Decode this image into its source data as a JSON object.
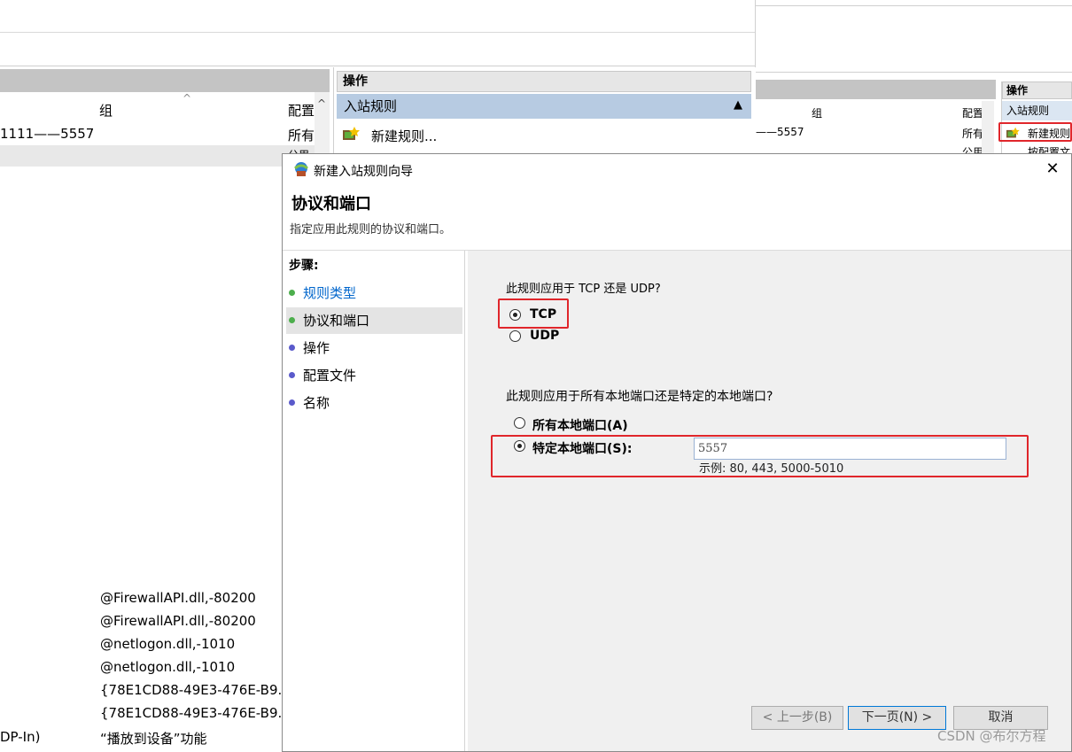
{
  "background": {
    "table_header": {
      "col_group": "组",
      "col_profile": "配置",
      "sort_arrow": "^"
    },
    "first_row": {
      "name": "1111——5557",
      "profile": "所有"
    },
    "second_row_profile": "公用",
    "rows": [
      {
        "group": "@FirewallAPI.dll,-80200"
      },
      {
        "group": "@FirewallAPI.dll,-80200"
      },
      {
        "group": "@netlogon.dll,-1010"
      },
      {
        "group": "@netlogon.dll,-1010"
      },
      {
        "group": "{78E1CD88-49E3-476E-B9..."
      },
      {
        "group": "{78E1CD88-49E3-476E-B9..."
      },
      {
        "name": "DP-In)",
        "group": "“播放到设备”功能"
      }
    ],
    "actions": {
      "header": "操作",
      "section": "入站规则",
      "collapse_arrow": "▲",
      "new_rule": "新建规则..."
    }
  },
  "right_panel": {
    "col_group": "组",
    "col_profile": "配置",
    "first_row_name": "——5557",
    "first_row_profile": "所有",
    "second_row_profile": "公用",
    "actions_header": "操作",
    "actions_section": "入站规则",
    "new_rule": "新建规则",
    "partial_item": "按配置文"
  },
  "dialog": {
    "title": "新建入站规则向导",
    "heading": "协议和端口",
    "subheading": "指定应用此规则的协议和端口。",
    "close": "✕",
    "steps_header": "步骤:",
    "steps": [
      {
        "label": "规则类型",
        "color": "#4cae4c",
        "link": true
      },
      {
        "label": "协议和端口",
        "color": "#4cae4c",
        "link": false
      },
      {
        "label": "操作",
        "color": "#5a5acb",
        "link": false
      },
      {
        "label": "配置文件",
        "color": "#5a5acb",
        "link": false
      },
      {
        "label": "名称",
        "color": "#5a5acb",
        "link": false
      }
    ],
    "protocol_question": "此规则应用于 TCP 还是 UDP?",
    "protocol_options": [
      {
        "label": "TCP",
        "selected": true
      },
      {
        "label": "UDP",
        "selected": false
      }
    ],
    "port_question": "此规则应用于所有本地端口还是特定的本地端口?",
    "port_options": [
      {
        "label": "所有本地端口(A)",
        "selected": false
      },
      {
        "label": "特定本地端口(S):",
        "selected": true
      }
    ],
    "port_value": "5557",
    "port_example": "示例: 80, 443, 5000-5010",
    "buttons": {
      "back": "< 上一步(B)",
      "next": "下一页(N) >",
      "cancel": "取消"
    }
  },
  "watermark": "CSDN @布尔方程",
  "colors": {
    "highlight_red": "#e0262b",
    "selected_section": "#b7cbe2",
    "link_blue": "#0066cc"
  }
}
